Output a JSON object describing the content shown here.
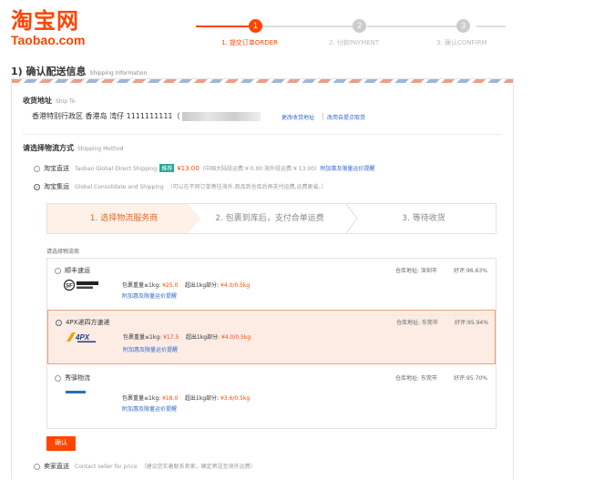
{
  "logo": {
    "cn": "淘宝网",
    "en": "Taobao.com"
  },
  "steps": [
    {
      "num": "1",
      "label": "1. 提交订单ORDER",
      "active": true
    },
    {
      "num": "2",
      "label": "2. 付款PAYMENT",
      "active": false
    },
    {
      "num": "3",
      "label": "3. 确认CONFIRM",
      "active": false
    }
  ],
  "section": {
    "title": "1) 确认配送信息",
    "subtitle": "Shipping Information"
  },
  "ship_to": {
    "title": "收货地址",
    "subtitle": "Ship To",
    "address": "香港特别行政区 香港岛 湾仔 1111111111（",
    "change_link": "更改收货地址",
    "pickup_link": "改用自提点取货"
  },
  "shipping_method": {
    "title": "请选择物流方式",
    "subtitle": "Shipping Method",
    "direct": {
      "name": "淘宝直送",
      "en": "Taobao Global Direct Shipping",
      "badge": "推荐",
      "price": "¥13.00",
      "note": "(中国大陆段运费:¥ 0.00 海外段运费:¥ 13.00)",
      "link": "附加惠及限量运价提醒"
    },
    "consolidate": {
      "name": "淘宝集运",
      "en": "Global Consolidate and Shipping",
      "note": "（可以在不同订单寄往海外,商品到仓库后再支付运费,运费更省。）"
    }
  },
  "progress": [
    {
      "label": "1. 选择物流服务商"
    },
    {
      "label": "2. 包裹到库后，支付合单运费"
    },
    {
      "label": "3. 等待收货"
    }
  ],
  "choose_label": "请选择物流商",
  "providers": [
    {
      "name": "顺丰速运",
      "warehouse": "仓库地址: 深圳市",
      "rating": "好评:96.63%",
      "logo": "sf-express-logo",
      "weight_label": "包裹重量≤1kg:",
      "weight_price": "¥25.0",
      "extra_label": "超出1kg部分:",
      "extra_price": "¥4.0/0.5kg",
      "link": "附加惠及限量运价提醒",
      "selected": false
    },
    {
      "name": "4PX递四方速递",
      "warehouse": "仓库地址: 东莞市",
      "rating": "好评:95.94%",
      "logo": "4px-logo",
      "weight_label": "包裹重量≤1kg:",
      "weight_price": "¥17.5",
      "extra_label": "超出1kg部分:",
      "extra_price": "¥4.0/0.5kg",
      "link": "附加惠及限量运价提醒",
      "selected": true
    },
    {
      "name": "秀驿物流",
      "warehouse": "仓库地址: 东莞市",
      "rating": "好评:95.70%",
      "logo": "xiuyi-logo",
      "weight_label": "包裹重量≤1kg:",
      "weight_price": "¥18.0",
      "extra_label": "超出1kg部分:",
      "extra_price": "¥3.6/0.5kg",
      "link": "附加惠及限量运价提醒",
      "selected": false
    }
  ],
  "confirm_button": "确认",
  "seller_direct": {
    "name": "卖家直送",
    "en": "Contact seller for price",
    "note": "（建议您实着联系卖家，确定寄送至境外运费）"
  },
  "colors": {
    "brand": "#ff4400",
    "link": "#3366cc",
    "selected_bg": "#fcece4",
    "badge": "#26a69a"
  }
}
